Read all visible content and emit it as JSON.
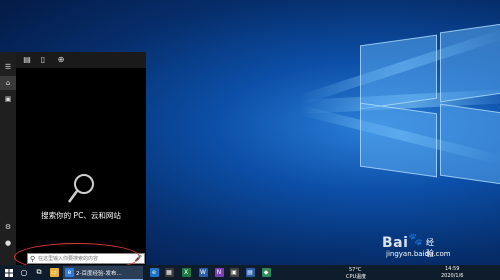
{
  "search": {
    "empty_message": "搜索你的 PC、云和网站",
    "placeholder": "在这里输入你要搜索的内容"
  },
  "taskbar": {
    "active_app_label": "2-百度经验-发布...",
    "temperature": "57°C",
    "cpu_label": "CPU温度",
    "time": "14:59",
    "date": "2020/1/6"
  },
  "watermark": {
    "logo": "Bai",
    "site": "jingyan.baidu.com"
  },
  "icons": {
    "rail": [
      "menu-icon",
      "home-icon",
      "documents-icon",
      "settings-icon",
      "user-icon"
    ],
    "topbar": [
      "apps-icon",
      "document-icon",
      "web-icon"
    ]
  },
  "colors": {
    "annotation": "#e23b3b",
    "taskbar": "#0f1c2c",
    "panel": "#000000"
  }
}
